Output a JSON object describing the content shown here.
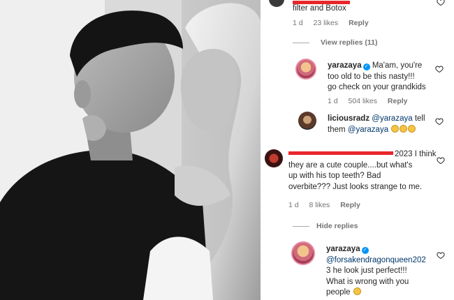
{
  "photo": {
    "description_icon": "couple-photo"
  },
  "comments": [
    {
      "id": "c1",
      "text": "filter and Botox",
      "meta": {
        "time": "1 d",
        "likes": "23 likes",
        "reply": "Reply"
      },
      "view_replies": "View replies (11)"
    },
    {
      "id": "r1",
      "username": "yarazaya",
      "verified": true,
      "text_line1": "Ma'am, you're",
      "text_line2": "too old to be this nasty!!!",
      "text_line3": "go check on your grandkids",
      "meta": {
        "time": "1 d",
        "likes": "504 likes",
        "reply": "Reply"
      }
    },
    {
      "id": "r2",
      "username": "liciousradz",
      "mention1": "@yarazaya",
      "text_mid": " tell",
      "text_line2_pre": "them ",
      "mention2": "@yarazaya"
    },
    {
      "id": "c2",
      "text_line1": "2023 I think",
      "text_line2": "they are a cute couple....but what's",
      "text_line3": "up with his top teeth? Bad",
      "text_line4": "overbite??? Just looks strange to me.",
      "meta": {
        "time": "1 d",
        "likes": "8 likes",
        "reply": "Reply"
      },
      "hide_replies": "Hide replies"
    },
    {
      "id": "r3",
      "username": "yarazaya",
      "verified": true,
      "mention": "@forsakendragonqueen202",
      "text_line2": "3 he look just perfect!!!",
      "text_line3": "What is wrong with you",
      "text_line4": "people"
    }
  ],
  "colors": {
    "link": "#00376b",
    "muted": "#737373",
    "verified": "#0095f6",
    "redaction": "#e8262a"
  },
  "icons": {
    "like": "heart-icon",
    "verified": "verified-badge-icon"
  }
}
